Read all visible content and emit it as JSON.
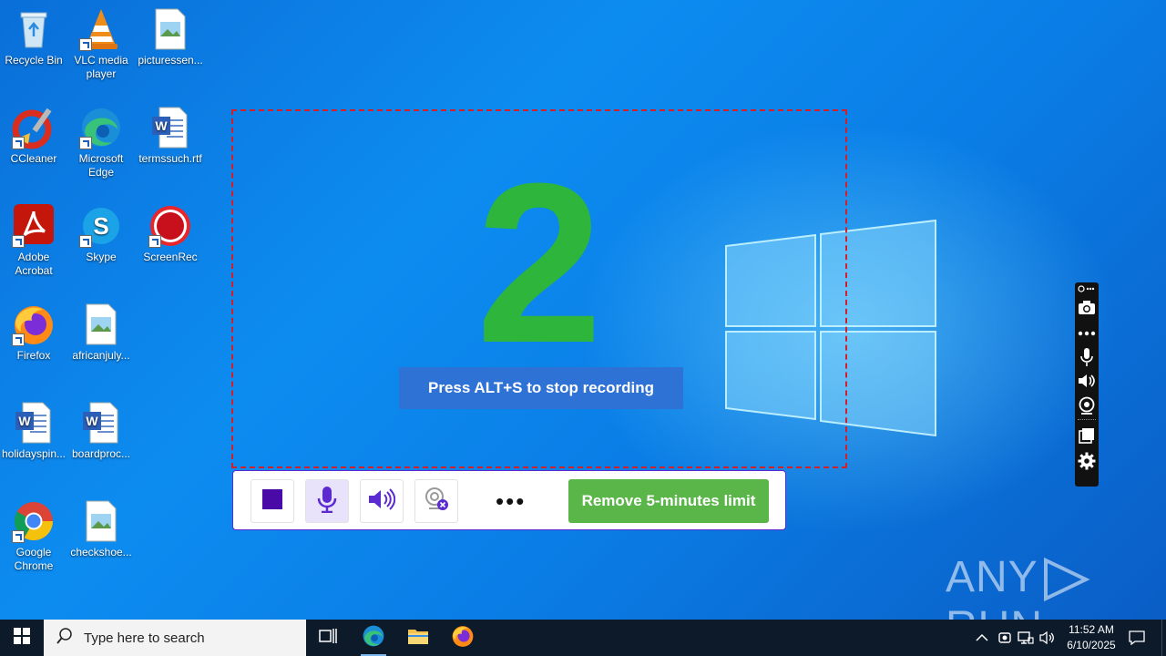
{
  "desktop": {
    "icons": [
      {
        "label": "Recycle Bin"
      },
      {
        "label": "VLC media player"
      },
      {
        "label": "picturessen..."
      },
      {
        "label": "CCleaner"
      },
      {
        "label": "Microsoft Edge"
      },
      {
        "label": "termssuch.rtf"
      },
      {
        "label": "Adobe Acrobat"
      },
      {
        "label": "Skype"
      },
      {
        "label": "ScreenRec"
      },
      {
        "label": "Firefox"
      },
      {
        "label": "africanjuly..."
      },
      {
        "label": "holidayspin..."
      },
      {
        "label": "boardproc..."
      },
      {
        "label": "Google Chrome"
      },
      {
        "label": "checkshoe..."
      }
    ]
  },
  "recorder": {
    "countdown": "2",
    "hint": "Press ALT+S to stop recording",
    "toolbar": {
      "stop_icon": "stop-icon",
      "mic_icon": "microphone-icon",
      "speaker_icon": "speaker-icon",
      "webcam_icon": "webcam-off-icon",
      "more_label": "•••",
      "upgrade_label": "Remove 5-minutes limit"
    },
    "colors": {
      "countdown": "#2db53c",
      "border": "#d2202a",
      "accent": "#5b2ad1",
      "upgrade": "#5bb64a",
      "hint_bg": "#2f72d6"
    }
  },
  "sidepanel": {
    "icons": [
      "pin-more-icon",
      "camera-icon",
      "more-icon",
      "microphone-icon",
      "speaker-icon",
      "webcam-icon",
      "windows-icon",
      "gear-icon"
    ]
  },
  "watermark": {
    "text_left": "ANY",
    "text_right": "RUN"
  },
  "taskbar": {
    "search_placeholder": "Type here to search",
    "apps": [
      "task-view-icon",
      "edge-icon",
      "file-explorer-icon",
      "firefox-icon"
    ],
    "clock_time": "11:52 AM",
    "clock_date": "6/10/2025"
  }
}
